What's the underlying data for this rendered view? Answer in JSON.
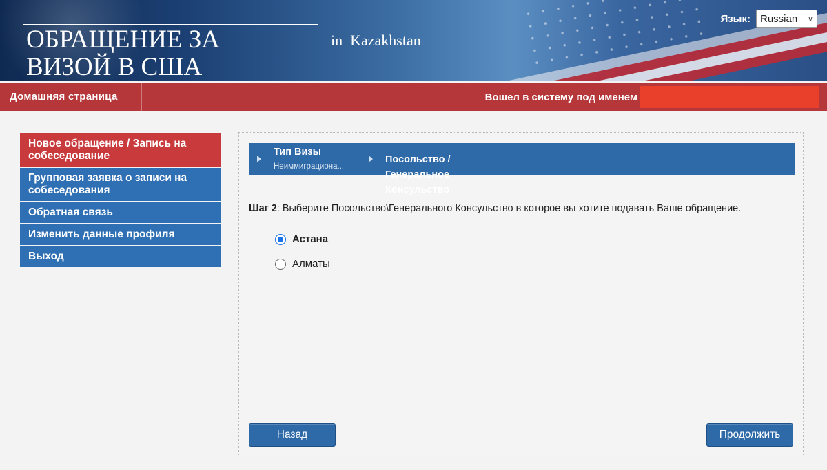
{
  "header": {
    "title_line1": "ОБРАЩЕНИЕ ЗА",
    "title_line2": "ВИЗОЙ В США",
    "subtitle": "in  Kazakhstan",
    "language_label": "Язык:",
    "language_value": "Russian"
  },
  "navbar": {
    "home": "Домашняя страница",
    "logged_in_as": "Вошел в систему под именем",
    "username": ""
  },
  "sidebar": {
    "items": [
      {
        "label": "Новое обращение / Запись на собеседование",
        "active": true
      },
      {
        "label": "Групповая заявка о записи на собеседования",
        "active": false
      },
      {
        "label": "Обратная связь",
        "active": false
      },
      {
        "label": "Изменить данные профиля",
        "active": false
      },
      {
        "label": "Выход",
        "active": false
      }
    ]
  },
  "steps": {
    "step1_title": "Тип Визы",
    "step1_value": "Неиммиграциона...",
    "step2_title": "Посольство / Генеральное Консульство"
  },
  "main": {
    "step_label": "Шаг 2",
    "instruction": ": Выберите Посольство\\Генерального Консульство в которое вы хотите подавать Ваше обращение.",
    "options": [
      {
        "label": "Астана",
        "selected": true
      },
      {
        "label": "Алматы",
        "selected": false
      }
    ],
    "back_button": "Назад",
    "continue_button": "Продолжить"
  },
  "colors": {
    "nav_red": "#b5373a",
    "active_red": "#c83a3c",
    "sidebar_blue": "#2f6fb4",
    "step_blue": "#2f6aa8",
    "radio_blue": "#1a73e8"
  }
}
